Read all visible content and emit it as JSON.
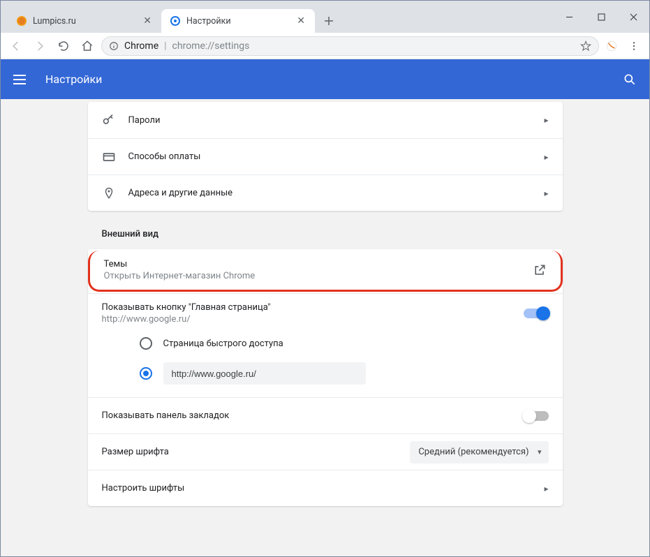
{
  "window": {
    "tabs": [
      {
        "title": "Lumpics.ru",
        "active": false,
        "favicon": "orange-circle"
      },
      {
        "title": "Настройки",
        "active": true,
        "favicon": "gear-blue"
      }
    ]
  },
  "omnibox": {
    "origin": "Chrome",
    "path": "chrome://settings"
  },
  "header": {
    "title": "Настройки"
  },
  "autofill_card": {
    "rows": [
      {
        "icon": "key",
        "label": "Пароли"
      },
      {
        "icon": "card",
        "label": "Способы оплаты"
      },
      {
        "icon": "pin",
        "label": "Адреса и другие данные"
      }
    ]
  },
  "appearance": {
    "section_title": "Внешний вид",
    "themes": {
      "title": "Темы",
      "subtitle": "Открыть Интернет-магазин Chrome"
    },
    "home_button": {
      "title": "Показывать кнопку \"Главная страница\"",
      "subtitle": "http://www.google.ru/",
      "enabled": true,
      "options": {
        "ntp_label": "Страница быстрого доступа",
        "custom_url": "http://www.google.ru/",
        "selected": "custom"
      }
    },
    "bookmarks_bar": {
      "title": "Показывать панель закладок",
      "enabled": false
    },
    "font_size": {
      "title": "Размер шрифта",
      "value": "Средний (рекомендуется)"
    },
    "customize_fonts": {
      "title": "Настроить шрифты"
    }
  }
}
